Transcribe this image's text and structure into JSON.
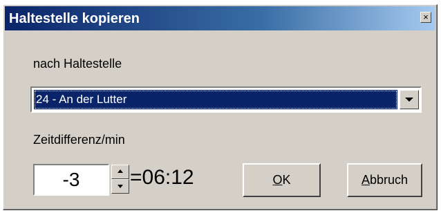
{
  "window": {
    "title": "Haltestelle kopieren",
    "close_glyph": "×"
  },
  "target": {
    "label": "nach Haltestelle",
    "selected": "24 - An der Lutter"
  },
  "diff": {
    "label": "Zeitdifferenz/min",
    "value": "-3",
    "result": "=06:12"
  },
  "buttons": {
    "ok_mnemonic": "O",
    "ok_rest": "K",
    "cancel_mnemonic": "A",
    "cancel_rest": "bbruch"
  },
  "icons": {
    "close": "close-icon",
    "dropdown": "chevron-down-icon",
    "spin_up": "arrow-up-icon",
    "spin_down": "arrow-down-icon"
  }
}
